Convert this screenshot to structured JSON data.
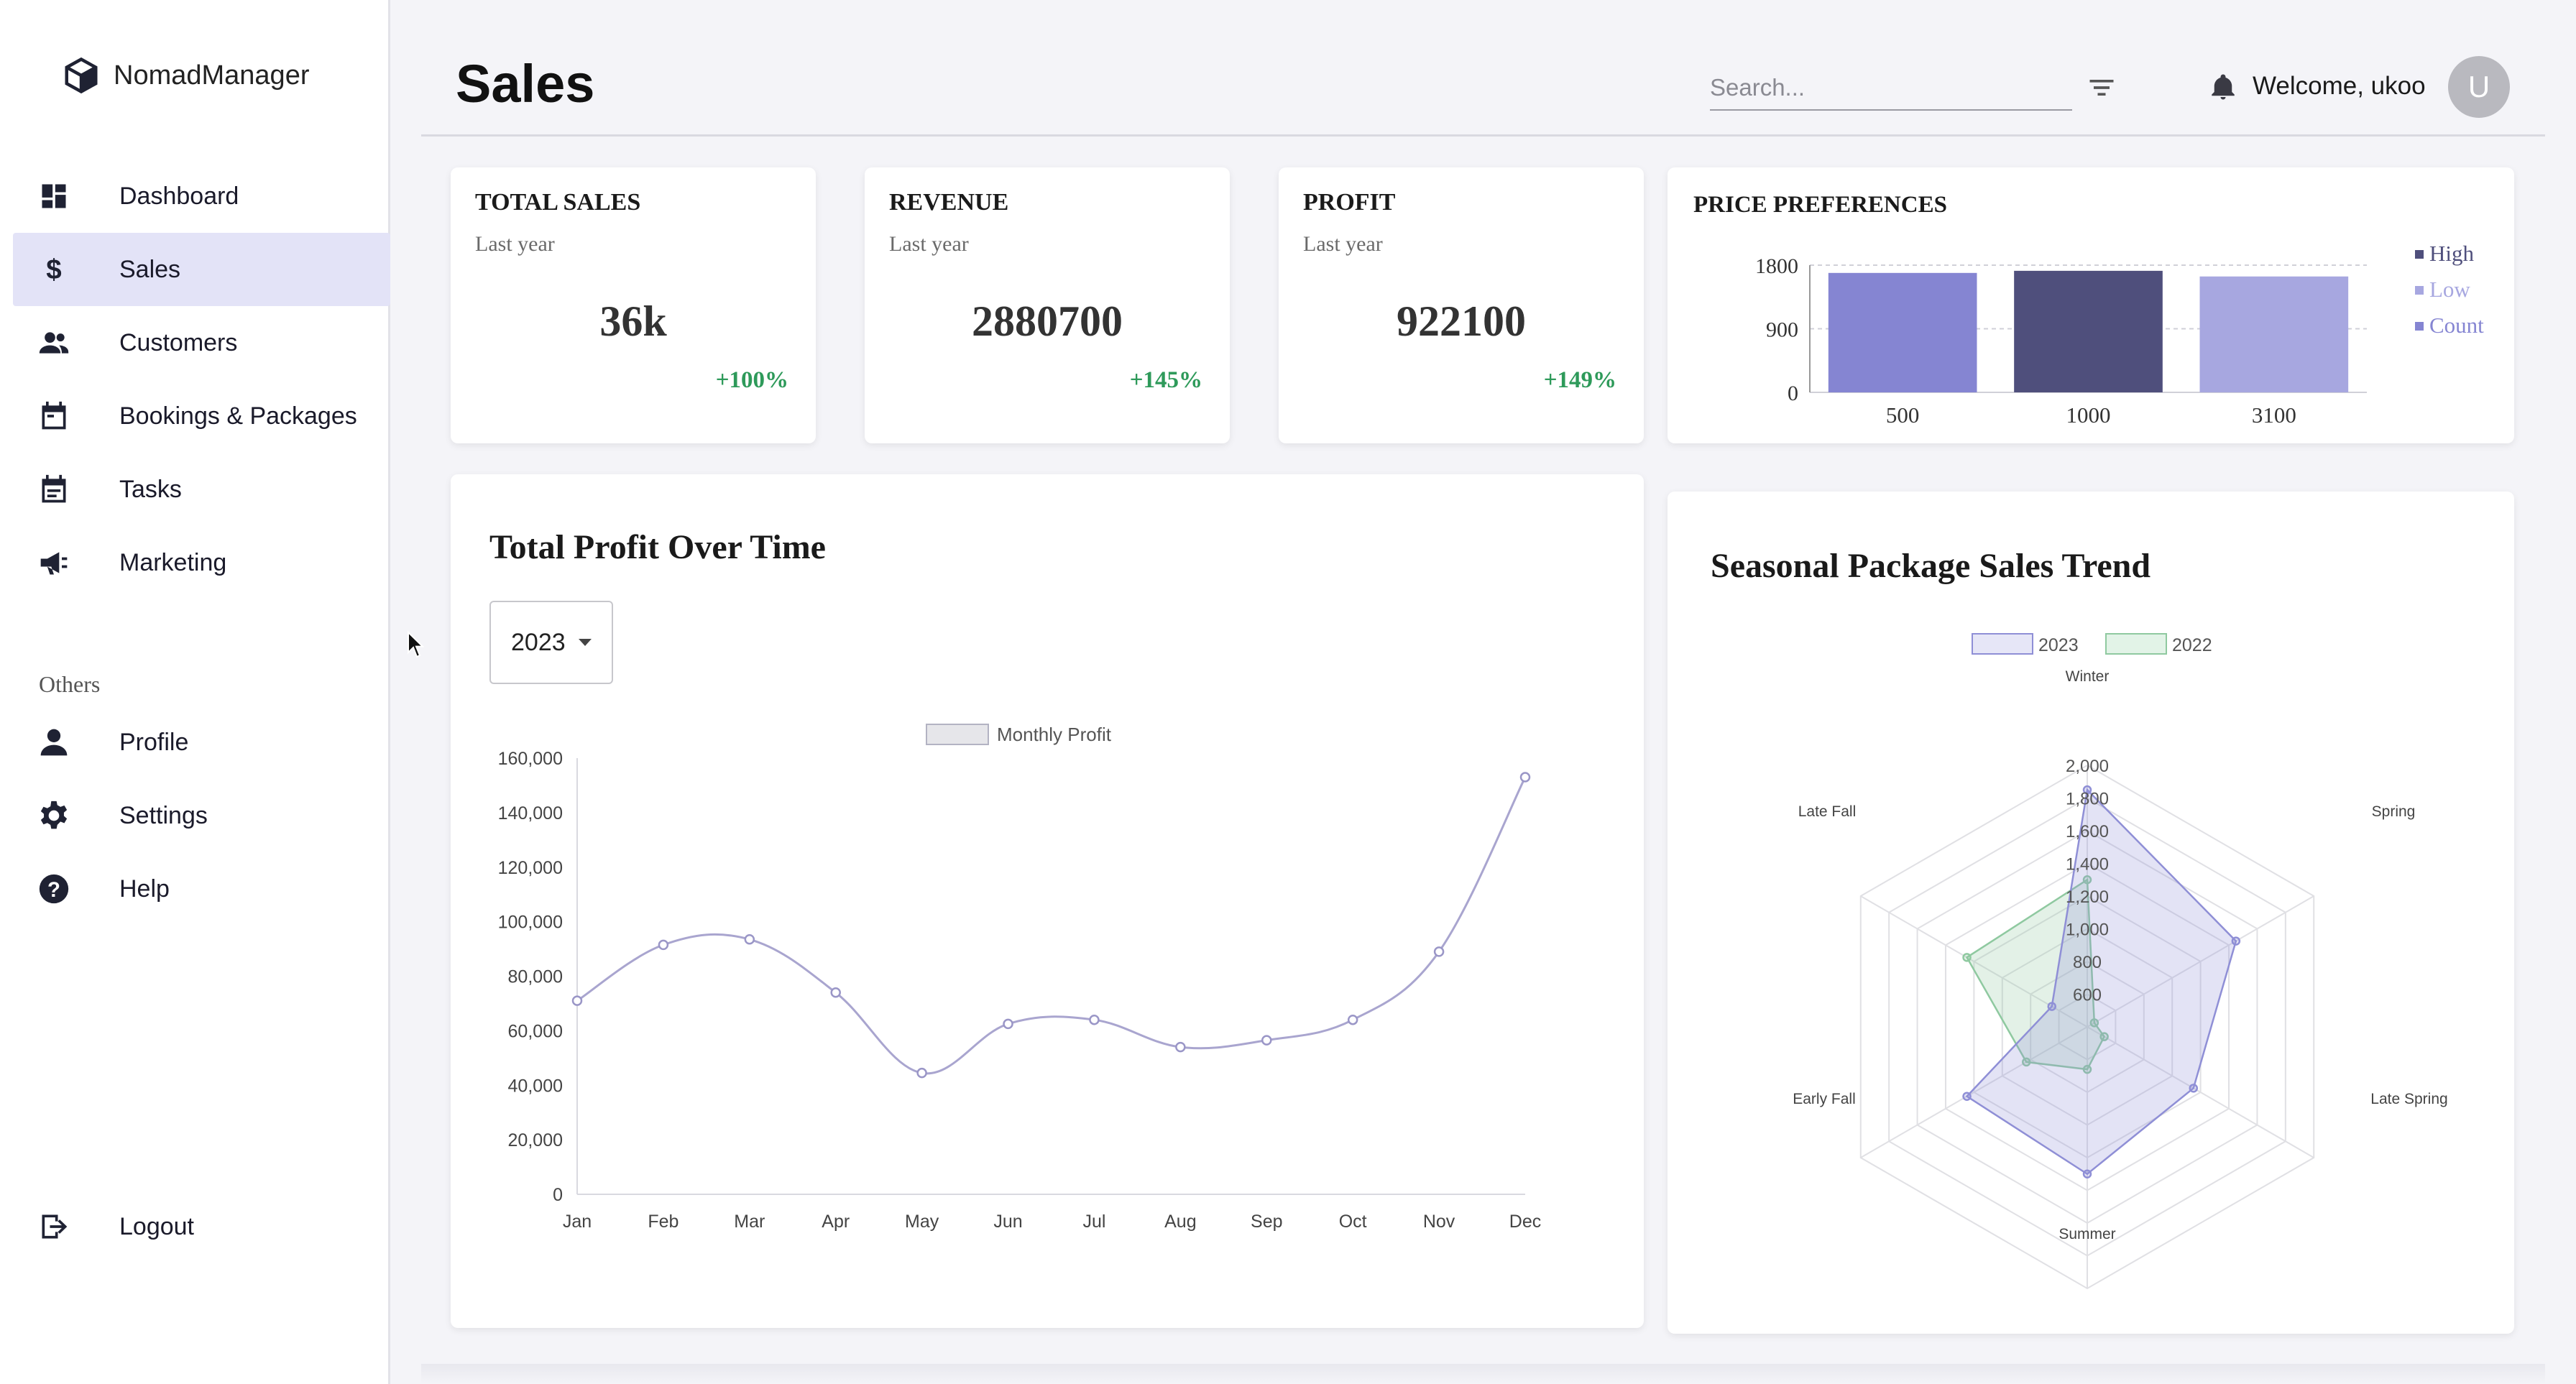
{
  "brand": {
    "name": "NomadManager",
    "icon": "cube-icon"
  },
  "nav": [
    {
      "label": "Dashboard",
      "icon": "dashboard-icon",
      "active": false
    },
    {
      "label": "Sales",
      "icon": "dollar-icon",
      "active": true
    },
    {
      "label": "Customers",
      "icon": "people-icon",
      "active": false
    },
    {
      "label": "Bookings & Packages",
      "icon": "calendar-icon",
      "active": false
    },
    {
      "label": "Tasks",
      "icon": "calendar-check-icon",
      "active": false
    },
    {
      "label": "Marketing",
      "icon": "megaphone-icon",
      "active": false
    }
  ],
  "others": {
    "label": "Others",
    "items": [
      {
        "label": "Profile",
        "icon": "person-icon"
      },
      {
        "label": "Settings",
        "icon": "gear-icon"
      },
      {
        "label": "Help",
        "icon": "help-icon"
      }
    ]
  },
  "logout": {
    "label": "Logout",
    "icon": "logout-icon"
  },
  "header": {
    "title": "Sales",
    "search_placeholder": "Search...",
    "welcome": "Welcome, ukoo",
    "avatar_initial": "U"
  },
  "stats": [
    {
      "title": "TOTAL SALES",
      "subtitle": "Last year",
      "value": "36k",
      "change": "+100%"
    },
    {
      "title": "REVENUE",
      "subtitle": "Last year",
      "value": "2880700",
      "change": "+145%"
    },
    {
      "title": "PROFIT",
      "subtitle": "Last year",
      "value": "922100",
      "change": "+149%"
    }
  ],
  "price_preferences": {
    "title": "PRICE PREFERENCES"
  },
  "profit_chart": {
    "title": "Total Profit Over Time",
    "year": "2023"
  },
  "seasonal_chart": {
    "title": "Seasonal Package Sales Trend"
  },
  "colors": {
    "accent": "#e3e3f7",
    "high": "#4f4f7c",
    "low": "#a7a7e0",
    "count": "#8585d2",
    "line": "#a9a5cf",
    "radar_2023": "#8f8fd6",
    "radar_2022": "#8fc9a0",
    "positive": "#2e9a5a"
  },
  "chart_data": [
    {
      "type": "bar",
      "title": "PRICE PREFERENCES",
      "categories": [
        "500",
        "1000",
        "3100"
      ],
      "values": [
        1690,
        1720,
        1640
      ],
      "bar_colors": [
        "#8585d2",
        "#4f4f7c",
        "#a7a7e0"
      ],
      "legend": [
        "High",
        "Low",
        "Count"
      ],
      "legend_colors": [
        "#4f4f7c",
        "#a7a7e0",
        "#8585d2"
      ],
      "legend_position": "right",
      "yticks": [
        0,
        900,
        1800
      ],
      "ylim": [
        0,
        1800
      ],
      "grid": true
    },
    {
      "type": "line",
      "title": "Total Profit Over Time",
      "categories": [
        "Jan",
        "Feb",
        "Mar",
        "Apr",
        "May",
        "Jun",
        "Jul",
        "Aug",
        "Sep",
        "Oct",
        "Nov",
        "Dec"
      ],
      "series": [
        {
          "name": "Monthly Profit",
          "values": [
            71000,
            91500,
            93500,
            74000,
            44500,
            62500,
            64000,
            54000,
            56500,
            64000,
            89000,
            153000
          ]
        }
      ],
      "yticks": [
        0,
        20000,
        40000,
        60000,
        80000,
        100000,
        120000,
        140000,
        160000
      ],
      "ytick_labels": [
        "0",
        "20,000",
        "40,000",
        "60,000",
        "80,000",
        "100,000",
        "120,000",
        "140,000",
        "160,000"
      ],
      "ylim": [
        0,
        160000
      ],
      "legend_position": "top",
      "grid": false
    },
    {
      "type": "radar",
      "title": "Seasonal Package Sales Trend",
      "axes": [
        "Winter",
        "Spring",
        "Late Spring",
        "Summer",
        "Early Fall",
        "Late Fall"
      ],
      "series": [
        {
          "name": "2023",
          "values": [
            1850,
            1450,
            1150,
            1300,
            1250,
            650
          ]
        },
        {
          "name": "2022",
          "values": [
            1300,
            450,
            520,
            660,
            830,
            1250
          ]
        }
      ],
      "scale_ticks": [
        600,
        800,
        1000,
        1200,
        1400,
        1600,
        1800,
        2000
      ],
      "scale_tick_labels": [
        "600",
        "800",
        "1,000",
        "1,200",
        "1,400",
        "1,600",
        "1,800",
        "2,000"
      ],
      "range": [
        400,
        2000
      ],
      "legend_position": "top"
    }
  ]
}
